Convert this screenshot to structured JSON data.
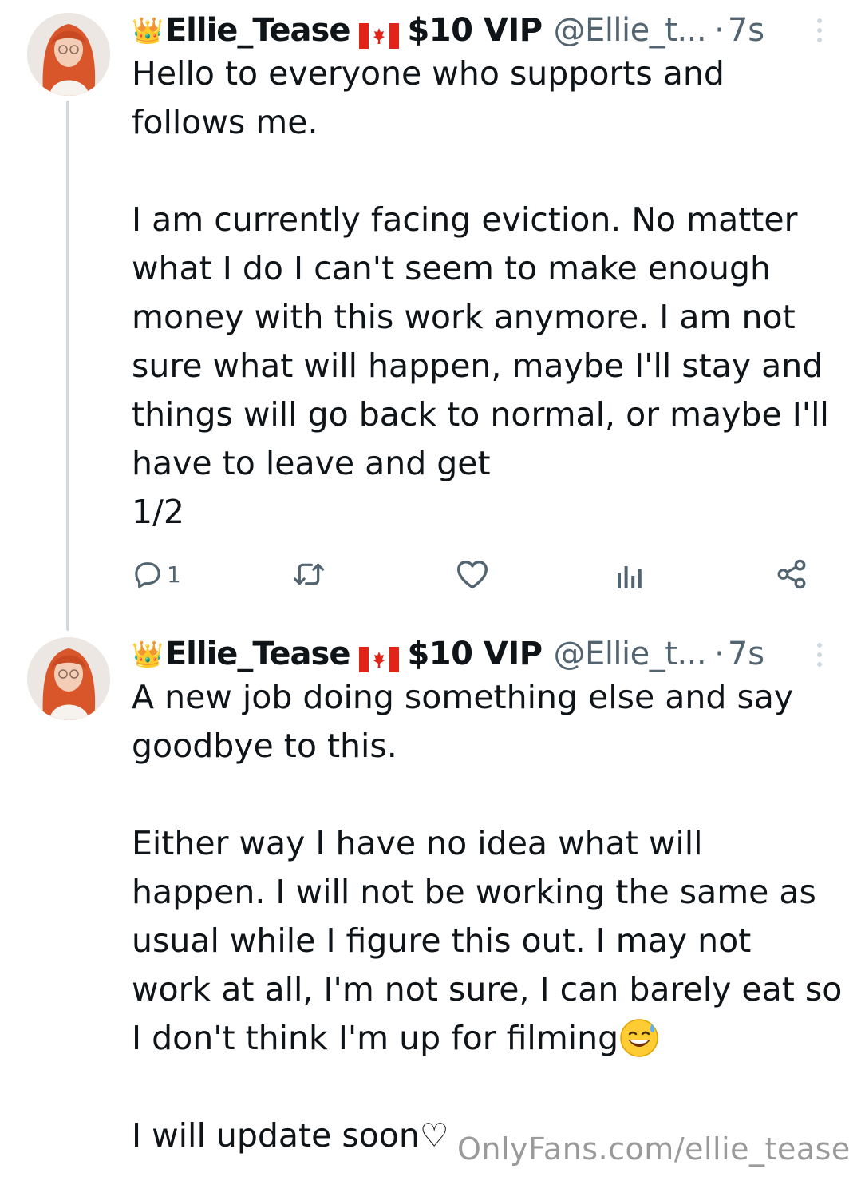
{
  "tweets": [
    {
      "crown": "👑",
      "display_name": "Ellie_Tease",
      "vip_label": "$10 VIP",
      "handle": "@Ellie_t...",
      "separator": "·",
      "time": "7s",
      "text": "Hello to everyone who supports and\nfollows me.\n\nI am currently facing eviction. No matter\nwhat I do I can't seem to make enough\nmoney with this work anymore. I am not\nsure what will happen, maybe I'll stay and\nthings will go back to normal, or maybe I'll\nhave to leave and get\n1/2",
      "reply_count": "1"
    },
    {
      "crown": "👑",
      "display_name": "Ellie_Tease",
      "vip_label": "$10 VIP",
      "handle": "@Ellie_t...",
      "separator": "·",
      "time": "7s",
      "text": "A new job doing something else and say\ngoodbye to this.\n\nEither way I have no idea what will\nhappen. I will not be working the same as\nusual while I figure this out. I may not\nwork at all, I'm not sure, I can barely eat so\nI don't think I'm up for filming",
      "text_end": "I will update soon♡"
    }
  ],
  "watermark": "OnlyFans.com/ellie_tease",
  "colors": {
    "text": "#0f1419",
    "secondary": "#536471",
    "thread_line": "#cfd9de",
    "flag_red": "#e2231a",
    "hair": "#d9562a"
  },
  "icons": [
    "reply-icon",
    "repost-icon",
    "like-icon",
    "views-icon",
    "share-icon",
    "more-icon",
    "canada-flag-icon",
    "grinning-sweat-emoji"
  ]
}
